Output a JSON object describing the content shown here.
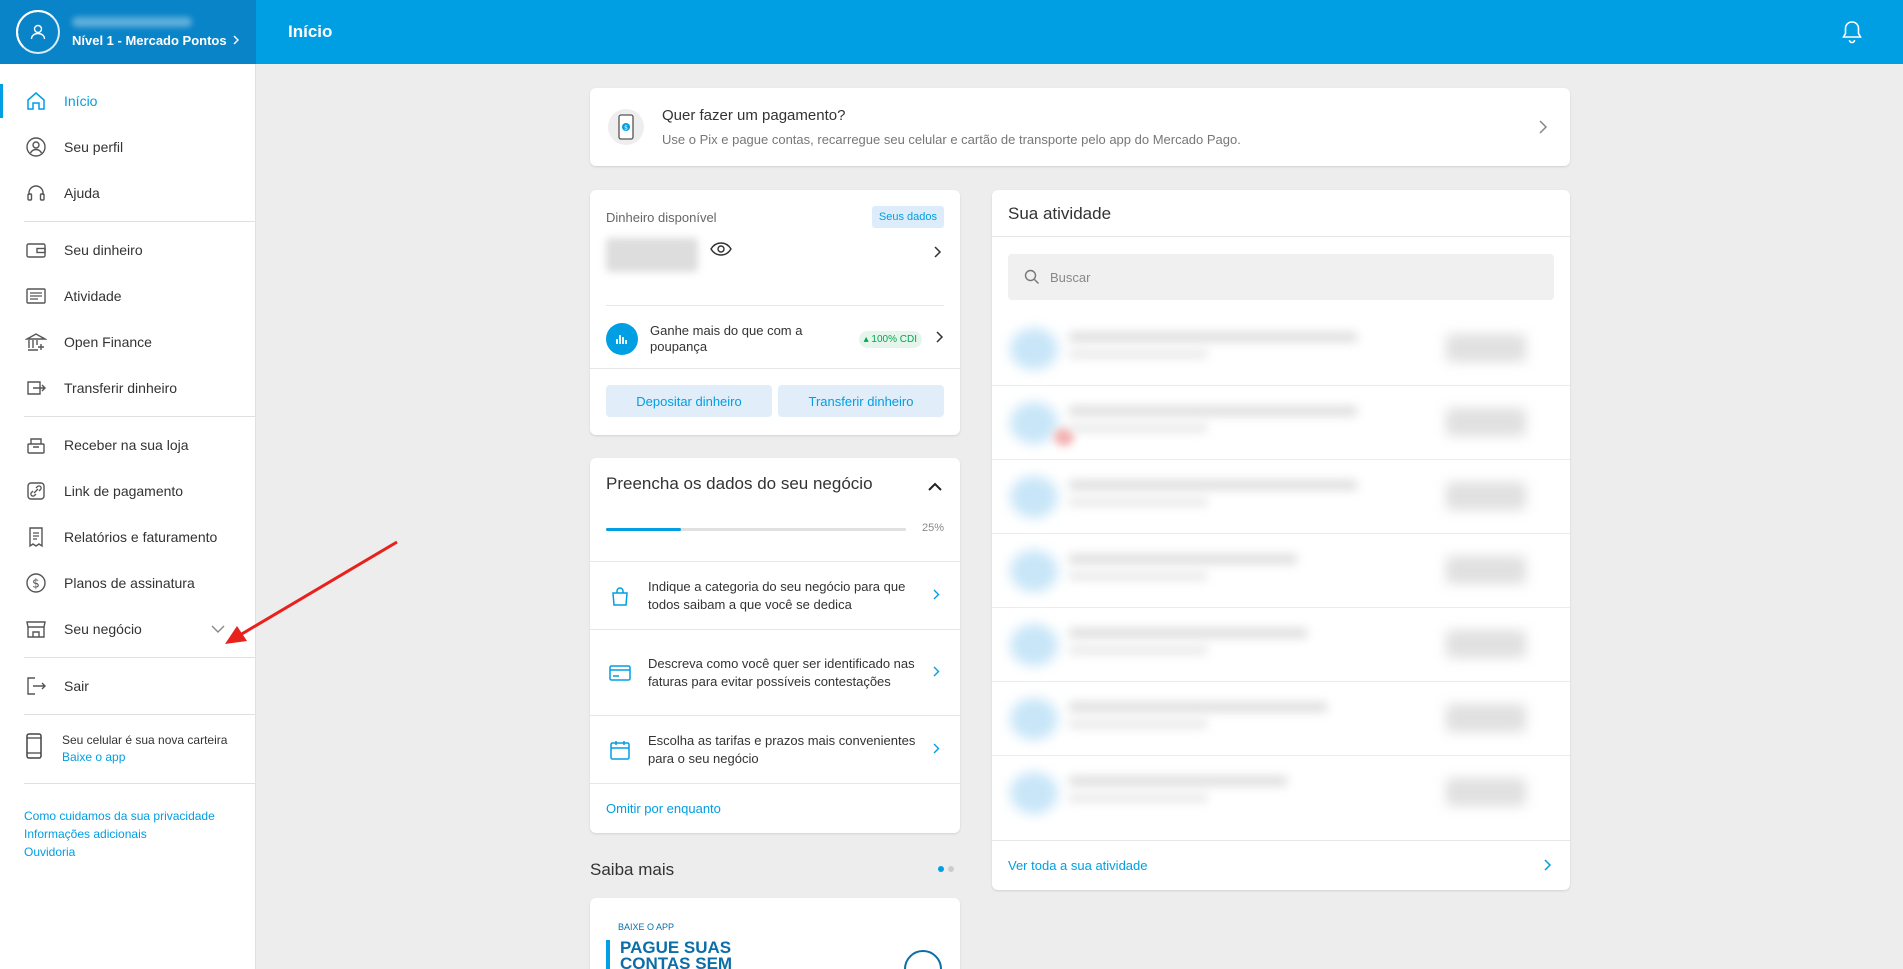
{
  "header": {
    "level_label": "Nível 1 - Mercado Pontos",
    "page_title": "Início"
  },
  "sidebar": {
    "items": [
      {
        "label": "Início",
        "icon": "home-icon"
      },
      {
        "label": "Seu perfil",
        "icon": "profile-icon"
      },
      {
        "label": "Ajuda",
        "icon": "headset-icon"
      },
      {
        "label": "Seu dinheiro",
        "icon": "wallet-icon"
      },
      {
        "label": "Atividade",
        "icon": "activity-icon"
      },
      {
        "label": "Open Finance",
        "icon": "bank-icon"
      },
      {
        "label": "Transferir dinheiro",
        "icon": "transfer-icon"
      },
      {
        "label": "Receber na sua loja",
        "icon": "cash-register-icon"
      },
      {
        "label": "Link de pagamento",
        "icon": "link-icon"
      },
      {
        "label": "Relatórios e faturamento",
        "icon": "receipt-icon"
      },
      {
        "label": "Planos de assinatura",
        "icon": "dollar-circle-icon"
      },
      {
        "label": "Seu negócio",
        "icon": "store-icon"
      },
      {
        "label": "Sair",
        "icon": "logout-icon"
      }
    ],
    "promo": {
      "title": "Seu celular é sua nova carteira",
      "link": "Baixe o app"
    },
    "footer_links": [
      "Como cuidamos da sua privacidade",
      "Informações adicionais",
      "Ouvidoria"
    ]
  },
  "payment_card": {
    "title": "Quer fazer um pagamento?",
    "subtitle": "Use o Pix e pague contas, recarregue seu celular e cartão de transporte pelo app do Mercado Pago."
  },
  "money_card": {
    "label": "Dinheiro disponível",
    "badge": "Seus dados",
    "yield_text": "Ganhe mais do que com a poupança",
    "cdi_badge": "100% CDI",
    "deposit_button": "Depositar dinheiro",
    "transfer_button": "Transferir dinheiro"
  },
  "business_card": {
    "title": "Preencha os dados do seu negócio",
    "progress": 0.25,
    "progress_label": "25%",
    "steps": [
      {
        "text": "Indique a categoria do seu negócio para que todos saibam a que você se dedica",
        "icon": "shopping-bag-icon"
      },
      {
        "text": "Descreva como você quer ser identificado nas faturas para evitar possíveis contestações",
        "icon": "card-icon"
      },
      {
        "text": "Escolha as tarifas e prazos mais convenientes para o seu negócio",
        "icon": "calendar-icon"
      }
    ],
    "skip_link": "Omitir por enquanto"
  },
  "saiba_mais": {
    "title": "Saiba mais",
    "tag": "BAIXE O APP",
    "headline": "PAGUE SUAS CONTAS SEM"
  },
  "activity": {
    "title": "Sua atividade",
    "search_placeholder": "Buscar",
    "see_all": "Ver toda a sua atividade"
  },
  "colors": {
    "brand_blue": "#009ee3",
    "header_dark": "#0a84c8",
    "annotation_red": "#e8211c"
  }
}
